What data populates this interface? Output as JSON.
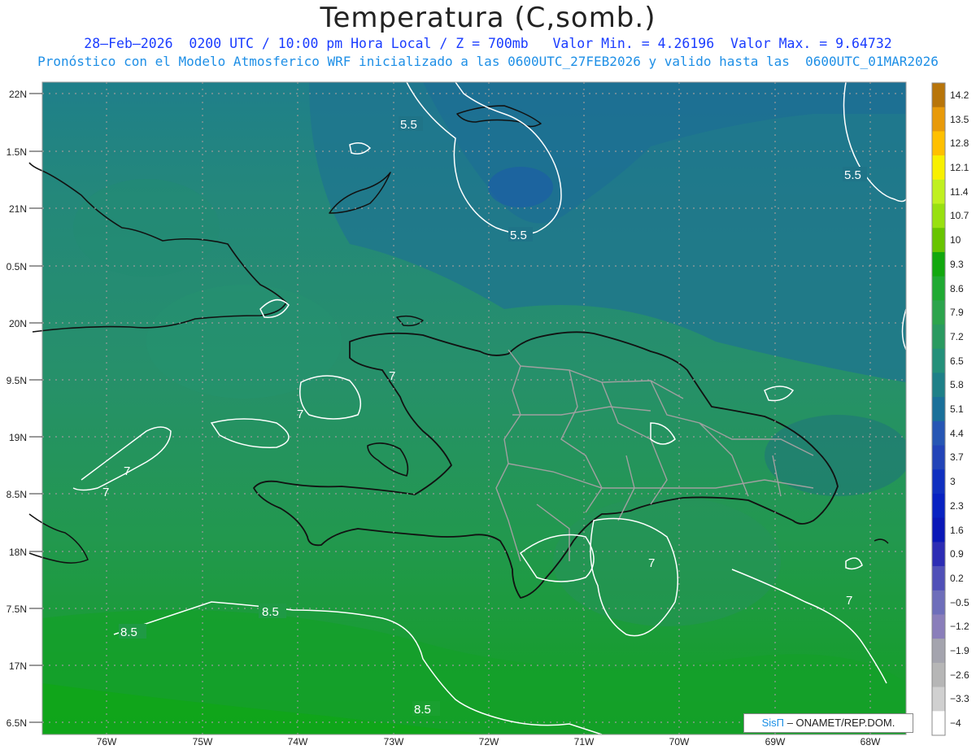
{
  "header": {
    "title": "Temperatura (C,somb.)",
    "line1": "28–Feb–2026  0200 UTC / 10:00 pm Hora Local / Z = 700mb   Valor Min. = 4.26196  Valor Max. = 9.64732",
    "line2": "Pronóstico con el Modelo Atmosferico WRF inicializado a las 0600UTC_27FEB2026 y valido hasta las  0600UTC_01MAR2026"
  },
  "map": {
    "lat_labels": [
      "22N",
      "1.5N",
      "21N",
      "0.5N",
      "20N",
      "9.5N",
      "19N",
      "8.5N",
      "18N",
      "7.5N",
      "17N",
      "6.5N"
    ],
    "lon_labels": [
      "76W",
      "75W",
      "74W",
      "73W",
      "72W",
      "71W",
      "70W",
      "69W",
      "68W"
    ],
    "contour_labels": [
      "5.5",
      "5.5",
      "5.5",
      "7",
      "7",
      "7",
      "7",
      "8.5",
      "8.5",
      "8.5",
      "7",
      "7"
    ]
  },
  "colorbar": {
    "labels": [
      "14.2",
      "13.5",
      "12.8",
      "12.1",
      "11.4",
      "10.7",
      "10",
      "9.3",
      "8.6",
      "7.9",
      "7.2",
      "6.5",
      "5.8",
      "5.1",
      "4.4",
      "3.7",
      "3",
      "2.3",
      "1.6",
      "0.9",
      "0.2",
      "−0.5",
      "−1.2",
      "−1.9",
      "−2.6",
      "−3.3",
      "−4"
    ],
    "colors": [
      "#b8750a",
      "#e89a0a",
      "#ffc000",
      "#f8f000",
      "#c0f020",
      "#98e010",
      "#68c400",
      "#12a80e",
      "#20aa32",
      "#2ca44c",
      "#2a9a60",
      "#24907a",
      "#1e8088",
      "#1a709a",
      "#2656b4",
      "#2244b8",
      "#1030c0",
      "#0822c2",
      "#0a18b8",
      "#2c2cb4",
      "#5050b8",
      "#6e6eba",
      "#8a7eba",
      "#a4a4ae",
      "#b6b6b6",
      "#d0d0d0",
      "#ffffff"
    ]
  },
  "credit": {
    "brand": "SisΠ",
    "text": "– ONAMET/REP.DOM."
  }
}
